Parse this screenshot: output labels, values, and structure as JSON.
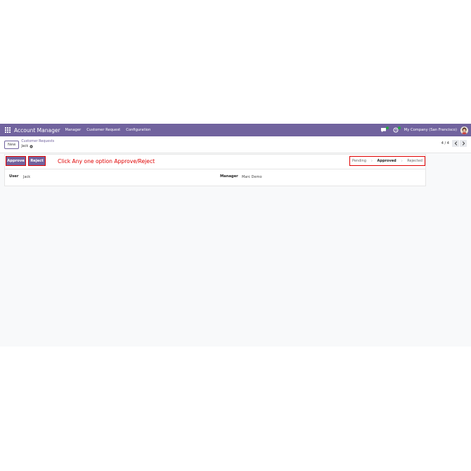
{
  "navbar": {
    "brand": "Account Manager",
    "menu": [
      "Manager",
      "Customer Request",
      "Configuration"
    ],
    "company": "My Company (San Francisco)",
    "accent_color": "#71639e"
  },
  "control_panel": {
    "new_label": "New",
    "breadcrumb_parent": "Customer Requests",
    "breadcrumb_current": "Jack",
    "pager_value": "4 / 4"
  },
  "statusbar": {
    "approve_label": "Approve",
    "reject_label": "Reject",
    "hint": "Click Any one option Approve/Reject",
    "stages": [
      "Pending",
      "Approved",
      "Rejected"
    ],
    "active_stage": "Approved",
    "highlight_color": "#e00000"
  },
  "form": {
    "user_label": "User",
    "user_value": "Jack",
    "manager_label": "Manager",
    "manager_value": "Marc Demo"
  },
  "icons": [
    "apps-grid-icon",
    "chat-icon",
    "activity-clock-icon",
    "gear-icon",
    "chevron-left-icon",
    "chevron-right-icon"
  ]
}
